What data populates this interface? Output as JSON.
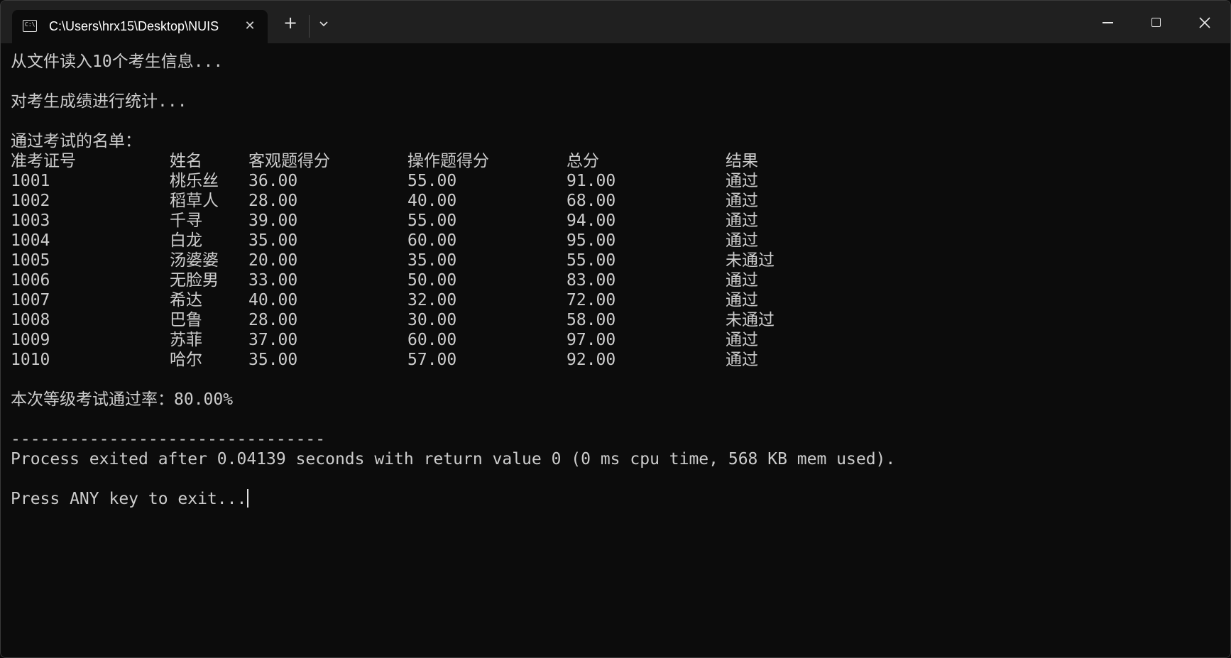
{
  "tab": {
    "title": "C:\\Users\\hrx15\\Desktop\\NUIS",
    "close": "✕",
    "new_tab": "+",
    "icon_label": "C:\\"
  },
  "window_controls": {
    "minimize": "minimize-icon",
    "maximize": "maximize-icon",
    "close": "✕"
  },
  "console": {
    "line_read": "从文件读入10个考生信息...",
    "line_stat": "对考生成绩进行统计...",
    "line_pass_list": "通过考试的名单：",
    "headers": [
      "准考证号",
      "姓名",
      "客观题得分",
      "操作题得分",
      "总分",
      "结果"
    ],
    "rows": [
      [
        "1001",
        "桃乐丝",
        "36.00",
        "55.00",
        "91.00",
        "通过"
      ],
      [
        "1002",
        "稻草人",
        "28.00",
        "40.00",
        "68.00",
        "通过"
      ],
      [
        "1003",
        "千寻",
        "39.00",
        "55.00",
        "94.00",
        "通过"
      ],
      [
        "1004",
        "白龙",
        "35.00",
        "60.00",
        "95.00",
        "通过"
      ],
      [
        "1005",
        "汤婆婆",
        "20.00",
        "35.00",
        "55.00",
        "未通过"
      ],
      [
        "1006",
        "无脸男",
        "33.00",
        "50.00",
        "83.00",
        "通过"
      ],
      [
        "1007",
        "希达",
        "40.00",
        "32.00",
        "72.00",
        "通过"
      ],
      [
        "1008",
        "巴鲁",
        "28.00",
        "30.00",
        "58.00",
        "未通过"
      ],
      [
        "1009",
        "苏菲",
        "37.00",
        "60.00",
        "97.00",
        "通过"
      ],
      [
        "1010",
        "哈尔",
        "35.00",
        "57.00",
        "92.00",
        "通过"
      ]
    ],
    "line_rate": "本次等级考试通过率：80.00%",
    "separator": "--------------------------------",
    "line_process": "Process exited after 0.04139 seconds with return value 0 (0 ms cpu time, 568 KB mem used).",
    "line_press": "Press ANY key to exit..."
  },
  "colors": {
    "background": "#0c0c0c",
    "titlebar": "#202020",
    "text": "#cccccc"
  }
}
